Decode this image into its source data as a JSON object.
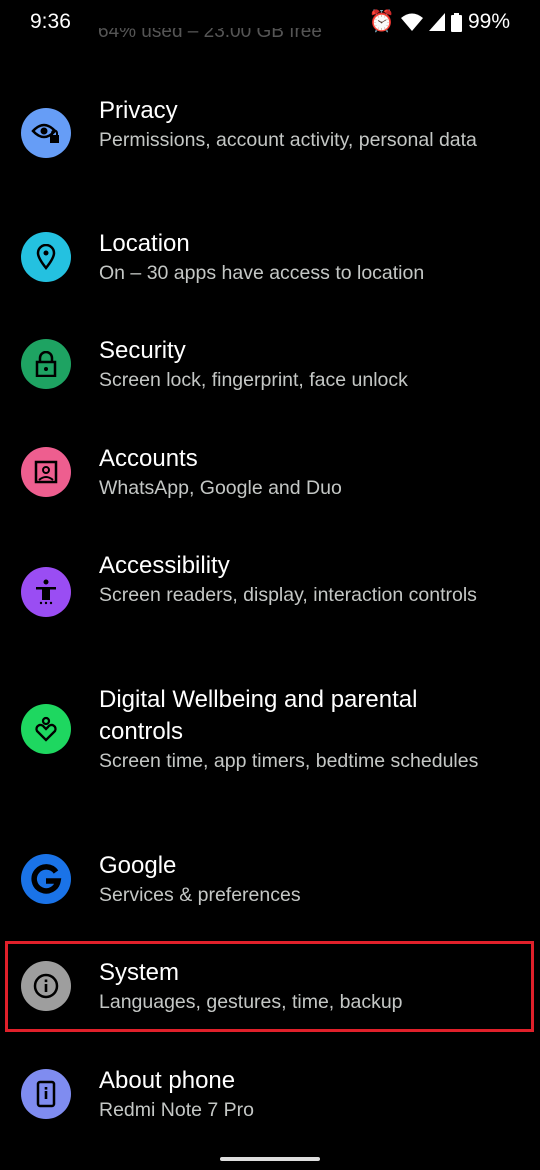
{
  "status_bar": {
    "time": "9:36",
    "battery": "99%",
    "icons": [
      "alarm-icon",
      "wifi-icon",
      "signal-icon",
      "battery-icon"
    ]
  },
  "scrolled_text": "64% used – 23.00 GB free",
  "items": [
    {
      "id": "privacy",
      "title": "Privacy",
      "subtitle": "Permissions, account activity, personal data",
      "icon": "eye-lock-icon",
      "color": "#669df6"
    },
    {
      "id": "location",
      "title": "Location",
      "subtitle": "On – 30 apps have access to location",
      "icon": "location-pin-icon",
      "color": "#24c1e0"
    },
    {
      "id": "security",
      "title": "Security",
      "subtitle": "Screen lock, fingerprint, face unlock",
      "icon": "lock-icon",
      "color": "#1ea362"
    },
    {
      "id": "accounts",
      "title": "Accounts",
      "subtitle": "WhatsApp, Google and Duo",
      "icon": "account-box-icon",
      "color": "#ee5e8f"
    },
    {
      "id": "accessibility",
      "title": "Accessibility",
      "subtitle": "Screen readers, display, interaction controls",
      "icon": "accessibility-icon",
      "color": "#9a4df3"
    },
    {
      "id": "digital-wellbeing",
      "title": "Digital Wellbeing and parental controls",
      "subtitle": "Screen time, app timers, bedtime schedules",
      "icon": "wellbeing-heart-icon",
      "color": "#1ed760"
    },
    {
      "id": "google",
      "title": "Google",
      "subtitle": "Services & preferences",
      "icon": "google-g-icon",
      "color": "#1a73e8"
    },
    {
      "id": "system",
      "title": "System",
      "subtitle": "Languages, gestures, time, backup",
      "icon": "info-icon",
      "color": "#9e9e9e",
      "highlighted": true
    },
    {
      "id": "about-phone",
      "title": "About phone",
      "subtitle": "Redmi Note 7 Pro",
      "icon": "phone-info-icon",
      "color": "#7f8cf0"
    }
  ],
  "highlight_color": "#e0202a"
}
